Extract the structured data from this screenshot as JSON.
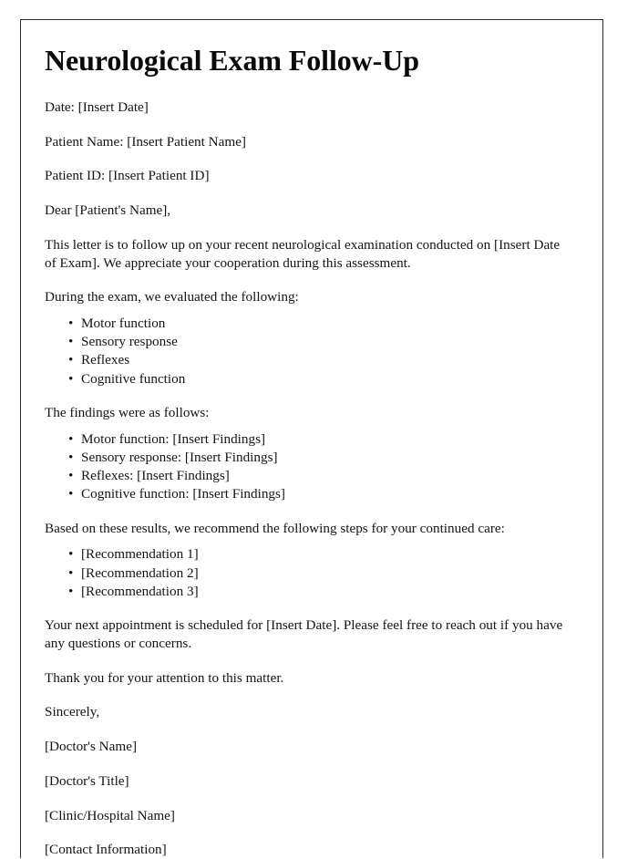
{
  "document": {
    "title": "Neurological Exam Follow-Up",
    "bullet_glyph": "•",
    "header_fields": [
      "Date: [Insert Date]",
      "Patient Name: [Insert Patient Name]",
      "Patient ID: [Insert Patient ID]"
    ],
    "salutation": "Dear [Patient's Name],",
    "intro_paragraph": "This letter is to follow up on your recent neurological examination conducted on [Insert Date of Exam]. We appreciate your cooperation during this assessment.",
    "evaluated_lead_in": "During the exam, we evaluated the following:",
    "evaluated_items": [
      "Motor function",
      "Sensory response",
      "Reflexes",
      "Cognitive function"
    ],
    "findings_lead_in": "The findings were as follows:",
    "findings_items": [
      "Motor function: [Insert Findings]",
      "Sensory response: [Insert Findings]",
      "Reflexes: [Insert Findings]",
      "Cognitive function: [Insert Findings]"
    ],
    "recommendations_lead_in": "Based on these results, we recommend the following steps for your continued care:",
    "recommendation_items": [
      "[Recommendation 1]",
      "[Recommendation 2]",
      "[Recommendation 3]"
    ],
    "appointment_paragraph": "Your next appointment is scheduled for [Insert Date]. Please feel free to reach out if you have any questions or concerns.",
    "thanks_paragraph": "Thank you for your attention to this matter.",
    "closing": "Sincerely,",
    "signature_block": [
      "[Doctor's Name]",
      "[Doctor's Title]",
      "[Clinic/Hospital Name]",
      "[Contact Information]"
    ]
  }
}
